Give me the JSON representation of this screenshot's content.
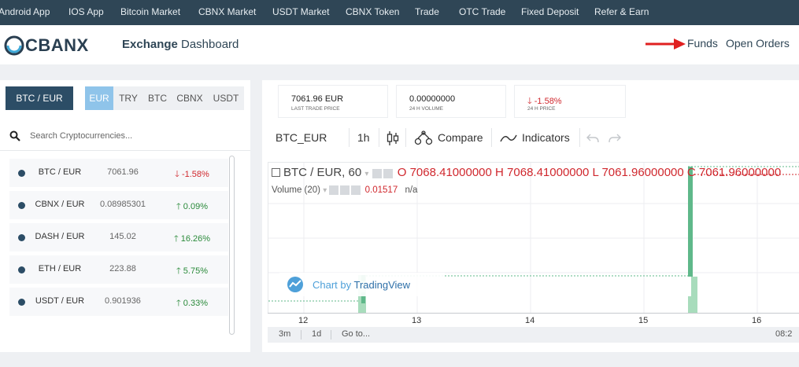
{
  "topnav": {
    "links": [
      "Android App",
      "IOS App",
      "Bitcoin Market",
      "CBNX Market",
      "USDT Market",
      "CBNX Token",
      "Trade",
      "OTC Trade",
      "Fixed Deposit",
      "Refer & Earn"
    ]
  },
  "header": {
    "logo_text": "CBANX",
    "nav_exchange": "Exchange",
    "nav_dashboard": "Dashboard",
    "nav_funds": "Funds",
    "nav_open_orders": "Open Orders",
    "arrow_color": "#e02020"
  },
  "market": {
    "selected_pair": "BTC / EUR",
    "currency_tabs": [
      "EUR",
      "TRY",
      "BTC",
      "CBNX",
      "USDT"
    ],
    "active_tab": "EUR",
    "search_placeholder": "Search Cryptocurrencies...",
    "rows": [
      {
        "pair": "BTC / EUR",
        "price": "7061.96",
        "change": "-1.58%",
        "direction": "down"
      },
      {
        "pair": "CBNX / EUR",
        "price": "0.08985301",
        "change": "0.09%",
        "direction": "up"
      },
      {
        "pair": "DASH / EUR",
        "price": "145.02",
        "change": "16.26%",
        "direction": "up"
      },
      {
        "pair": "ETH / EUR",
        "price": "223.88",
        "change": "5.75%",
        "direction": "up"
      },
      {
        "pair": "USDT / EUR",
        "price": "0.901936",
        "change": "0.33%",
        "direction": "up"
      }
    ]
  },
  "stats": {
    "last_price": "7061.96 EUR",
    "last_price_label": "LAST TRADE PRICE",
    "volume": "0.00000000",
    "volume_label": "24 H VOLUME",
    "change": "-1.58%",
    "change_label": "24 H PRICE"
  },
  "toolbar": {
    "symbol": "BTC_EUR",
    "interval": "1h",
    "compare": "Compare",
    "indicators": "Indicators"
  },
  "chart": {
    "legend_symbol": "BTC / EUR, 60",
    "open": "O 7068.41000000",
    "high": "H 7068.41000000",
    "low": "L 7061.96000000",
    "close": "C 7061.96000000",
    "volume_label": "Volume (20)",
    "volume_value": "0.01517",
    "volume_na": "n/a",
    "watermark_prefix": "Chart by ",
    "watermark_brand": "TradingView",
    "x_ticks": [
      "12",
      "13",
      "14",
      "15",
      "16"
    ],
    "time_label": "08:2",
    "up_color": "#5fb88a"
  },
  "bottombar": {
    "range_3m": "3m",
    "range_1d": "1d",
    "goto": "Go to..."
  }
}
